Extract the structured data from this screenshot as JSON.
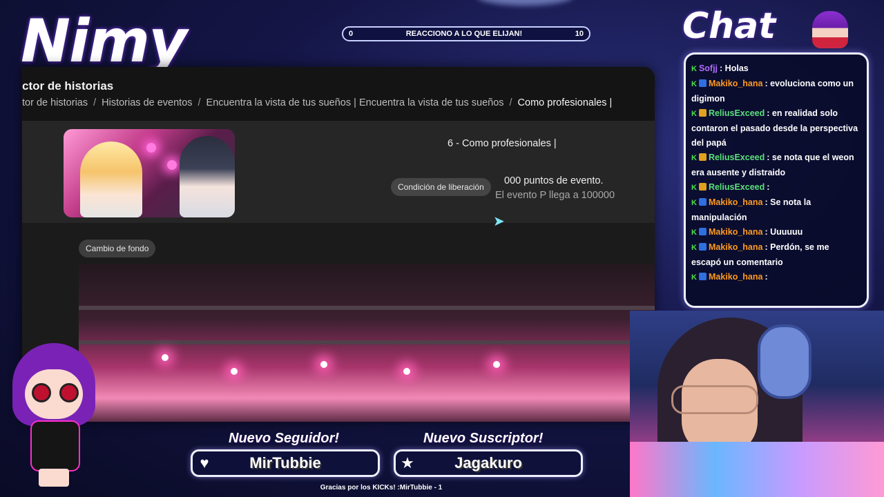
{
  "overlay": {
    "streamer_name": "Nimy",
    "goal": {
      "start": "0",
      "label": "REACCIONO A LO QUE ELIJAN!",
      "end": "10",
      "progress": 0
    },
    "chat_heading": "Chat",
    "follower_heading": "Nuevo Seguidor!",
    "follower_name": "MirTubbie",
    "subscriber_heading": "Nuevo Suscriptor!",
    "subscriber_name": "Jagakuro",
    "credits": "Gracias por los KICKs! :MirTubbie - 1"
  },
  "capture": {
    "page_title": "ctor de historias",
    "breadcrumb": [
      "tor de historias",
      "Historias de eventos",
      "Encuentra la vista de tus sueños | Encuentra la vista de tus sueños",
      "Como profesionales |"
    ],
    "breadcrumb_separator": "/",
    "episode_title": "6 - Como profesionales |",
    "unlock_condition_label": "Condición de liberación",
    "points_text": "000 puntos de evento.",
    "event_requirement": "El evento P llega a 100000",
    "background_change_label": "Cambio de fondo"
  },
  "chat": {
    "messages": [
      {
        "user": "Sofjj",
        "color": "#b06cff",
        "badges": [
          "kick"
        ],
        "text": ": Holas"
      },
      {
        "user": "Makiko_hana",
        "color": "#ff9a1f",
        "badges": [
          "kick",
          "sub"
        ],
        "text": ": evoluciona como un digimon"
      },
      {
        "user": "ReliusExceed",
        "color": "#5be07a",
        "badges": [
          "kick",
          "crown"
        ],
        "text": ": en realidad solo contaron el pasado desde la perspectiva del papá"
      },
      {
        "user": "ReliusExceed",
        "color": "#5be07a",
        "badges": [
          "kick",
          "crown"
        ],
        "text": ": se nota que el weon era ausente y distraido"
      },
      {
        "user": "ReliusExceed",
        "color": "#5be07a",
        "badges": [
          "kick",
          "crown"
        ],
        "text": ":"
      },
      {
        "user": "Makiko_hana",
        "color": "#ff9a1f",
        "badges": [
          "kick",
          "sub"
        ],
        "text": ": Se nota la manipulación"
      },
      {
        "user": "Makiko_hana",
        "color": "#ff9a1f",
        "badges": [
          "kick",
          "sub"
        ],
        "text": ": Uuuuuu"
      },
      {
        "user": "Makiko_hana",
        "color": "#ff9a1f",
        "badges": [
          "kick",
          "sub"
        ],
        "text": ": Perdón, se me escapó un comentario"
      },
      {
        "user": "Makiko_hana",
        "color": "#ff9a1f",
        "badges": [
          "kick",
          "sub"
        ],
        "text": ":"
      }
    ]
  },
  "icons": {
    "follower": "heart-icon",
    "subscriber": "star-icon"
  }
}
